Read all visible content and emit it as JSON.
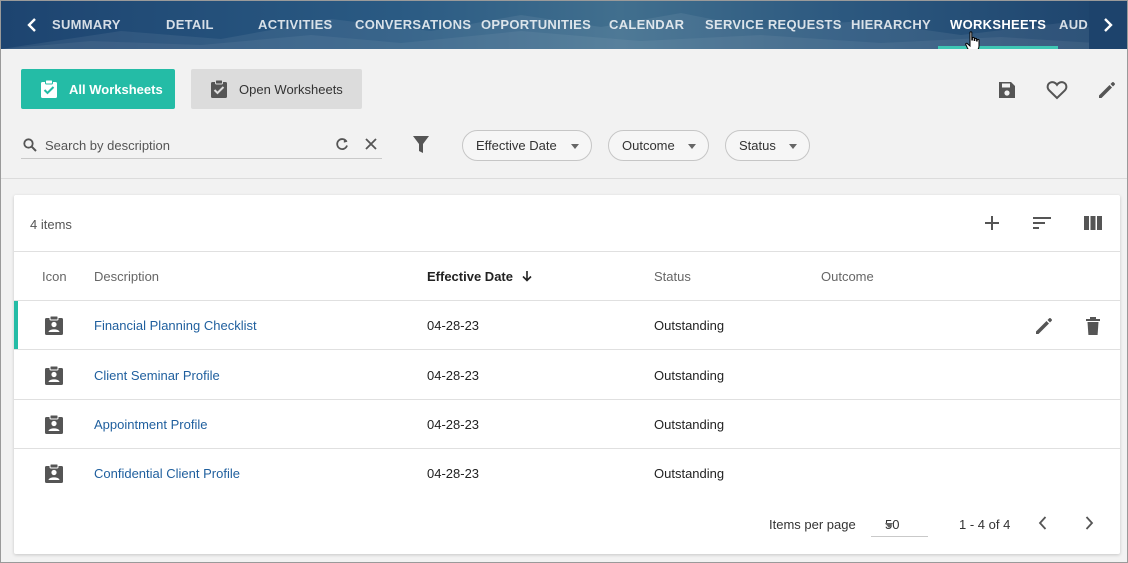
{
  "nav": {
    "tabs": [
      "SUMMARY",
      "DETAIL",
      "ACTIVITIES",
      "CONVERSATIONS",
      "OPPORTUNITIES",
      "CALENDAR",
      "SERVICE REQUESTS",
      "HIERARCHY",
      "WORKSHEETS",
      "AUD"
    ],
    "active": "WORKSHEETS"
  },
  "toolbar": {
    "all_worksheets": "All Worksheets",
    "open_worksheets": "Open Worksheets"
  },
  "search": {
    "placeholder": "Search by description",
    "value": ""
  },
  "filters": [
    "Effective Date",
    "Outcome",
    "Status"
  ],
  "table": {
    "item_count": "4 items",
    "columns": {
      "icon": "Icon",
      "description": "Description",
      "effective_date": "Effective Date",
      "status": "Status",
      "outcome": "Outcome"
    },
    "sort_column": "Effective Date",
    "rows": [
      {
        "description": "Financial Planning Checklist",
        "effective_date": "04-28-23",
        "status": "Outstanding",
        "outcome": ""
      },
      {
        "description": "Client Seminar Profile",
        "effective_date": "04-28-23",
        "status": "Outstanding",
        "outcome": ""
      },
      {
        "description": "Appointment Profile",
        "effective_date": "04-28-23",
        "status": "Outstanding",
        "outcome": ""
      },
      {
        "description": "Confidential Client Profile",
        "effective_date": "04-28-23",
        "status": "Outstanding",
        "outcome": ""
      }
    ]
  },
  "pagination": {
    "items_per_page_label": "Items per page",
    "items_per_page": "50",
    "range": "1 - 4 of 4"
  },
  "colors": {
    "accent": "#24bca6",
    "link": "#1f5f9e",
    "nav_bg": "#1d4470"
  },
  "icons": [
    "chevron-left-icon",
    "chevron-right-icon",
    "clipboard-check-icon",
    "save-icon",
    "heart-icon",
    "pencil-icon",
    "search-icon",
    "refresh-icon",
    "close-icon",
    "filter-icon",
    "plus-icon",
    "sort-icon",
    "columns-icon",
    "clipboard-person-icon",
    "delete-icon",
    "arrow-down-icon"
  ]
}
